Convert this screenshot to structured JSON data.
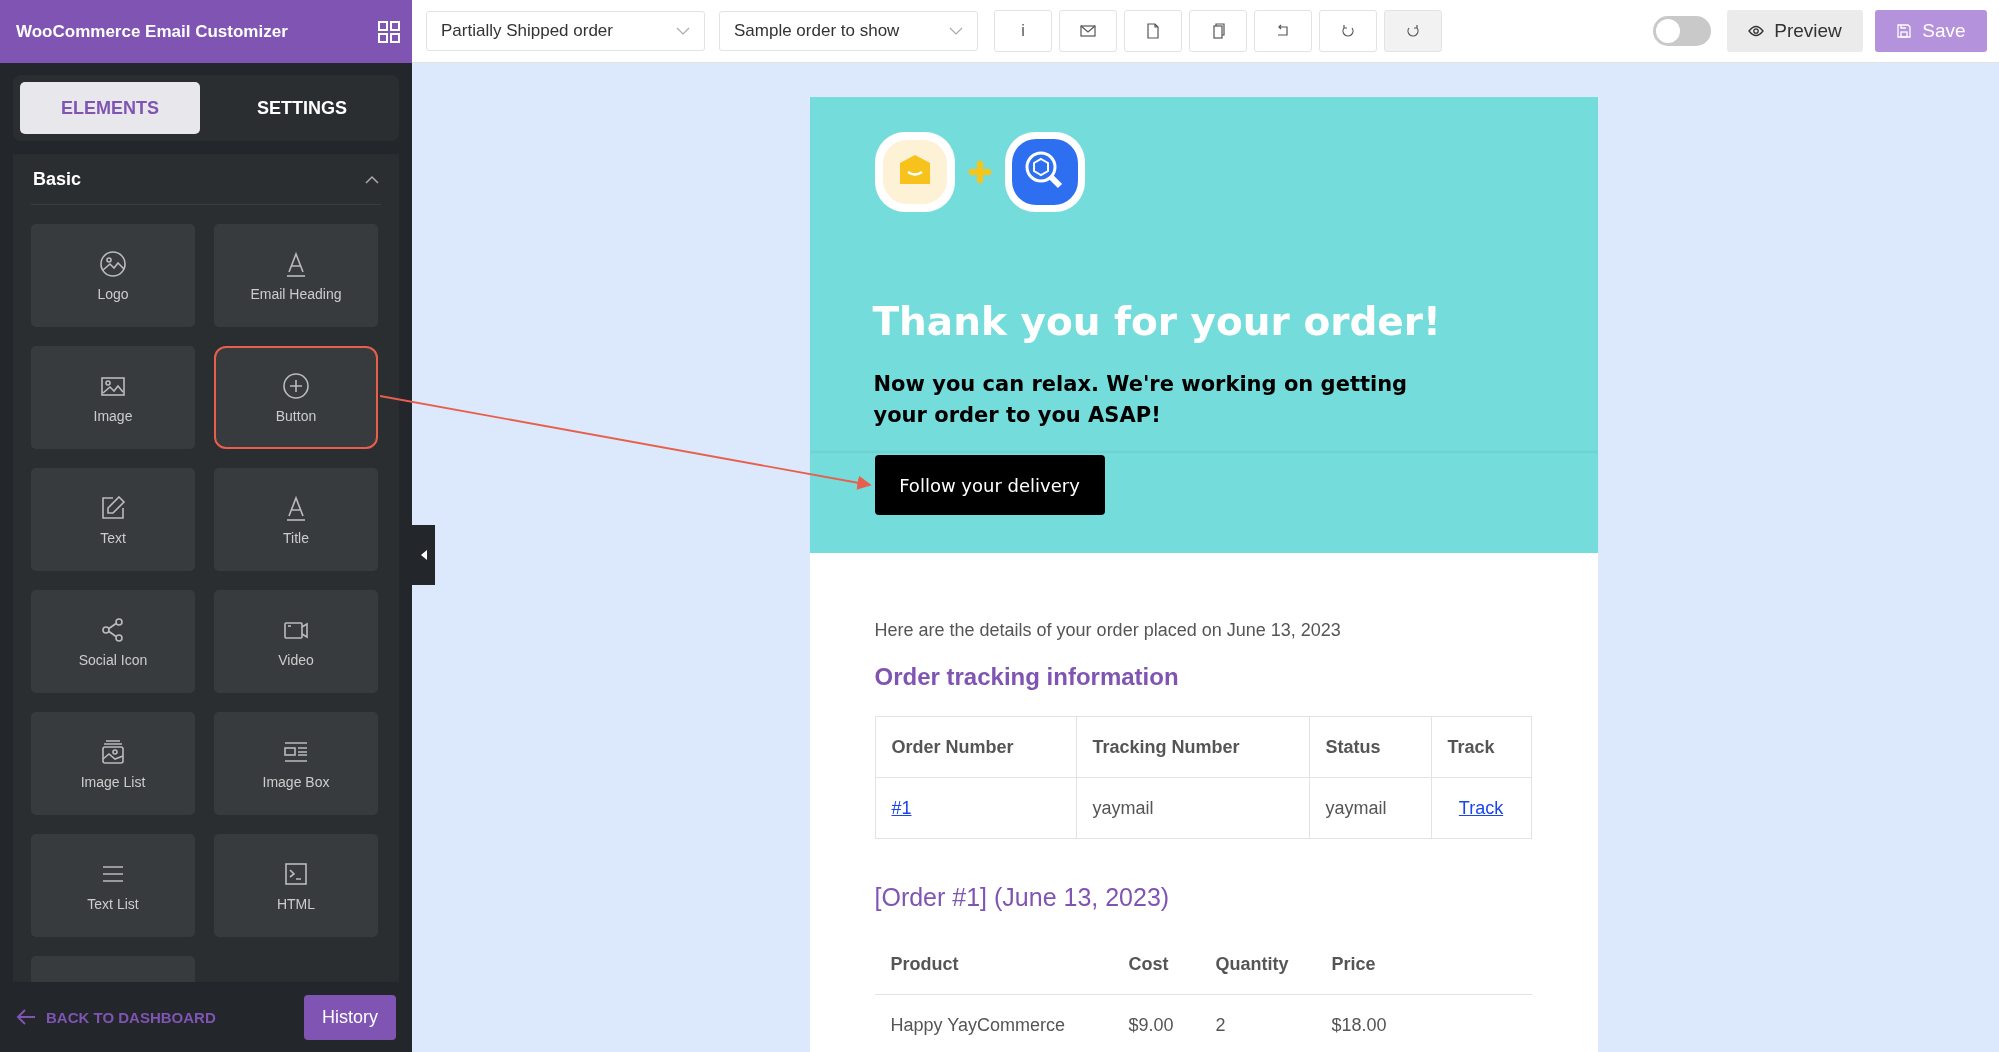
{
  "app_title": "WooCommerce Email Customizer",
  "sidebar": {
    "tabs": [
      {
        "label": "ELEMENTS",
        "selected": true
      },
      {
        "label": "SETTINGS",
        "selected": false
      }
    ],
    "section": {
      "title": "Basic",
      "expanded": true
    },
    "elements": [
      {
        "label": "Logo",
        "kind": "logo",
        "highlighted": false
      },
      {
        "label": "Email Heading",
        "kind": "heading",
        "highlighted": false
      },
      {
        "label": "Image",
        "kind": "image",
        "highlighted": false
      },
      {
        "label": "Button",
        "kind": "button",
        "highlighted": true
      },
      {
        "label": "Text",
        "kind": "text",
        "highlighted": false
      },
      {
        "label": "Title",
        "kind": "title",
        "highlighted": false
      },
      {
        "label": "Social Icon",
        "kind": "social",
        "highlighted": false
      },
      {
        "label": "Video",
        "kind": "video",
        "highlighted": false
      },
      {
        "label": "Image List",
        "kind": "image_list",
        "highlighted": false
      },
      {
        "label": "Image Box",
        "kind": "image_box",
        "highlighted": false
      },
      {
        "label": "Text List",
        "kind": "text_list",
        "highlighted": false
      },
      {
        "label": "HTML",
        "kind": "html",
        "highlighted": false
      }
    ],
    "back_link": "BACK TO DASHBOARD",
    "history_button": "History"
  },
  "toolbar": {
    "template_select": "Partially Shipped order",
    "order_select": "Sample order to show",
    "icon_buttons": [
      {
        "kind": "info",
        "label": "i",
        "disabled": false
      },
      {
        "kind": "mail",
        "disabled": false
      },
      {
        "kind": "file",
        "disabled": false
      },
      {
        "kind": "copy",
        "disabled": false
      },
      {
        "kind": "reset",
        "disabled": false
      },
      {
        "kind": "undo",
        "disabled": false
      },
      {
        "kind": "redo",
        "disabled": true
      }
    ],
    "toggle": {
      "on": false
    },
    "preview_button": "Preview",
    "save_button": "Save"
  },
  "email": {
    "heading": "Thank you for your order!",
    "subheading": "Now you can relax. We're working on getting your order to you ASAP!",
    "cta_button": "Follow your delivery",
    "intro": "Here are the details of your order placed on June 13, 2023",
    "tracking_title": "Order tracking information",
    "tracking_table": {
      "columns": [
        "Order Number",
        "Tracking Number",
        "Status",
        "Track"
      ],
      "rows": [
        {
          "order": "#1",
          "tracking": "yaymail",
          "status": "yaymail",
          "track": "Track"
        }
      ]
    },
    "order_title": "[Order #1] (June 13, 2023)",
    "order_table": {
      "columns": [
        "Product",
        "Cost",
        "Quantity",
        "Price"
      ],
      "rows": [
        [
          "Happy YayCommerce",
          "$9.00",
          "2",
          "$18.00"
        ]
      ]
    }
  }
}
